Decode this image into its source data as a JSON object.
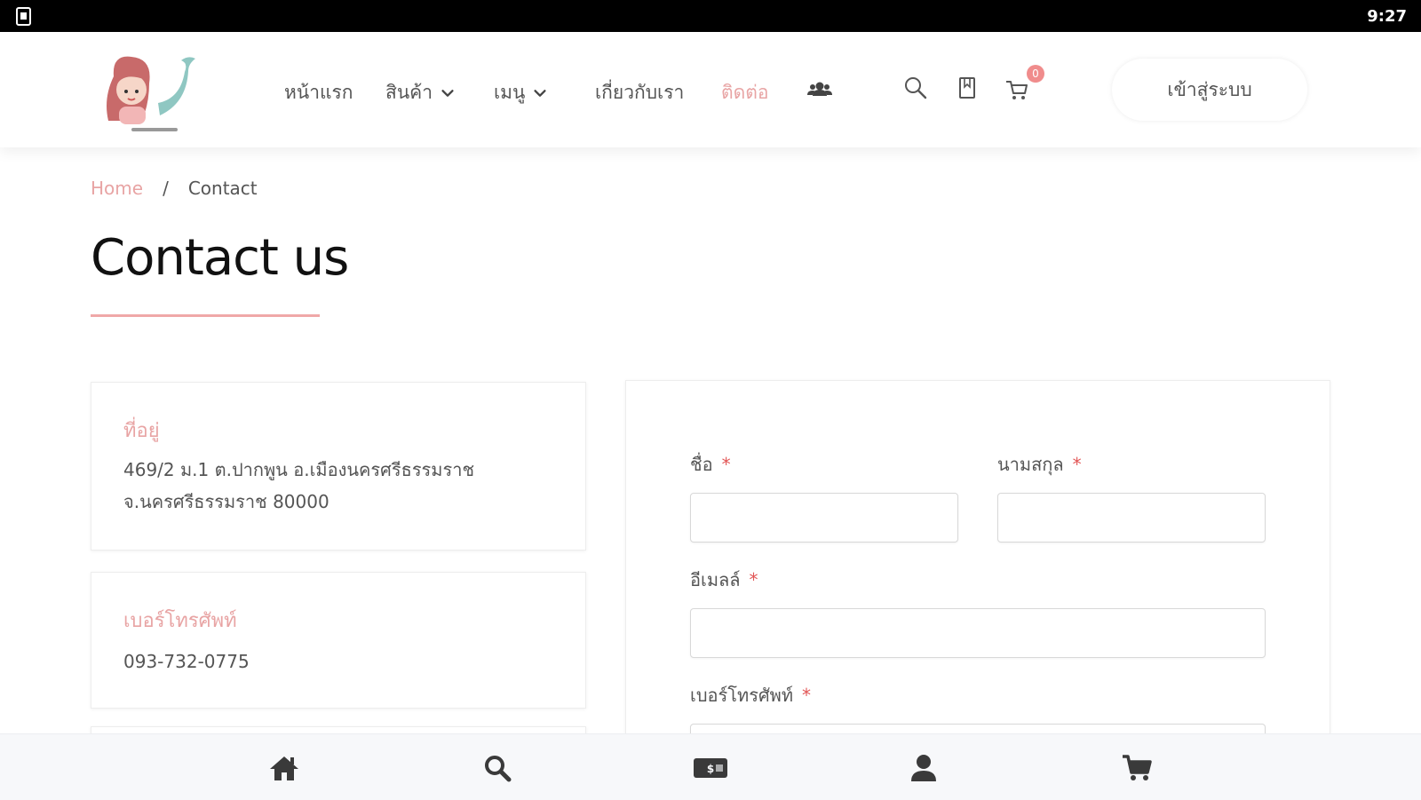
{
  "status_bar": {
    "time": "9:27"
  },
  "nav": {
    "items": [
      {
        "label": "หน้าแรก"
      },
      {
        "label": "สินค้า"
      },
      {
        "label": "เมนู"
      },
      {
        "label": "เกี่ยวกับเรา"
      },
      {
        "label": "ติดต่อ"
      }
    ],
    "cart_count": "0",
    "login_label": "เข้าสู่ระบบ"
  },
  "breadcrumb": {
    "home": "Home",
    "separator": "/",
    "current": "Contact"
  },
  "page": {
    "title": "Contact us"
  },
  "contact_cards": [
    {
      "title": "ที่อยู่",
      "lines": [
        "469/2 ม.1 ต.ปากพูน อ.เมืองนครศรีธรรมราช",
        "จ.นครศรีธรรมราช 80000"
      ]
    },
    {
      "title": "เบอร์โทรศัพท์",
      "lines": [
        "093-732-0775"
      ]
    }
  ],
  "form": {
    "first_name_label": "ชื่อ",
    "last_name_label": "นามสกุล",
    "email_label": "อีเมลล์",
    "phone_label": "เบอร์โทรศัพท์",
    "required_mark": "*",
    "first_name_value": "",
    "last_name_value": "",
    "email_value": "",
    "phone_value": ""
  },
  "colors": {
    "accent": "#e8a4a4",
    "required": "#e25555",
    "badge": "#f08c8c"
  },
  "icons": [
    "search-icon",
    "bookmark-icon",
    "cart-icon",
    "users-icon",
    "home-icon",
    "money-icon",
    "user-icon"
  ]
}
